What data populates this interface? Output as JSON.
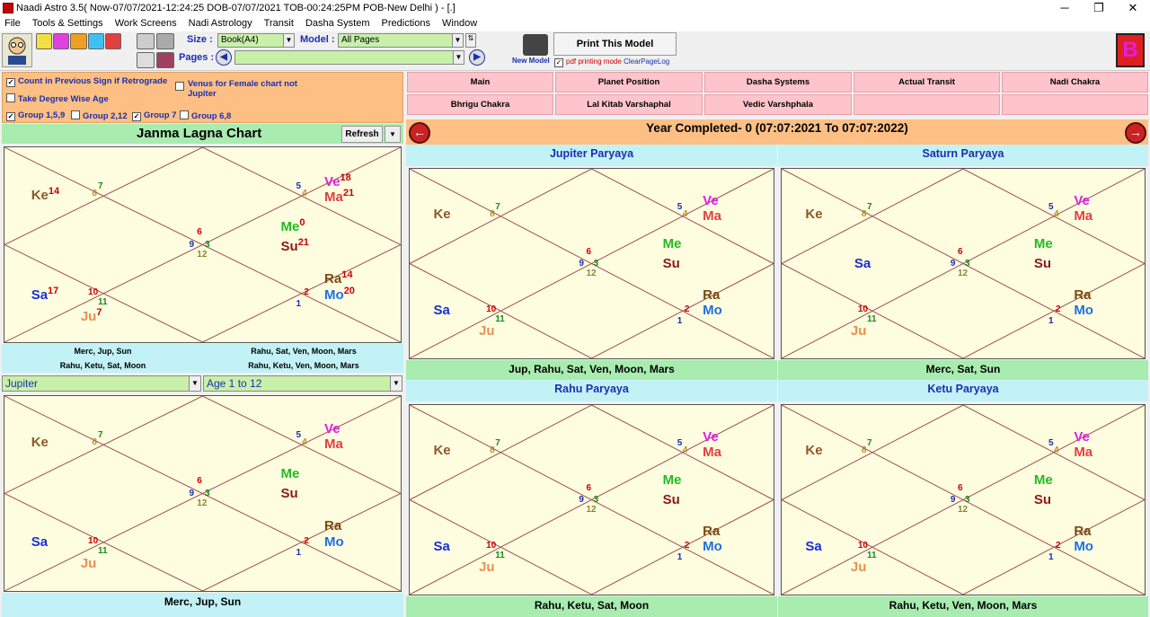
{
  "window": {
    "title": "Naadi Astro 3.5( Now-07/07/2021-12:24:25 DOB-07/07/2021 TOB-00:24:25PM POB-New Delhi ) - [.]",
    "minimize": "─",
    "maximize": "❐",
    "close": "✕"
  },
  "menu": [
    "File",
    "Tools & Settings",
    "Work Screens",
    "Nadi Astrology",
    "Transit",
    "Dasha System",
    "Predictions",
    "Window"
  ],
  "toolbar": {
    "size_label": "Size :",
    "size_value": "Book(A4)",
    "model_label": "Model :",
    "model_value": "All Pages",
    "pages_label": "Pages :",
    "pages_value": "",
    "print_label": "Print This Model",
    "new_model": "New Model",
    "pdf_label": "pdf printing mode",
    "clear_log": "ClearPageLog",
    "logo_letter": "B"
  },
  "options": {
    "count_prev": "Count in Previous Sign if Retrograde",
    "degree_age": "Take Degree Wise Age",
    "venus_female": "Venus for Female chart not Jupiter",
    "group159": "Group 1,5,9",
    "group212": "Group 2,12",
    "group7": "Group 7",
    "group68": "Group 6,8"
  },
  "lagna": {
    "title": "Janma Lagna Chart",
    "refresh": "Refresh"
  },
  "houses": [
    "6",
    "7",
    "5",
    "8",
    "4",
    "9",
    "3",
    "12",
    "10",
    "2",
    "11",
    "1"
  ],
  "main_chart": {
    "ke": "Ke",
    "ke_deg": "14",
    "ve": "Ve",
    "ve_deg": "18",
    "ma": "Ma",
    "ma_deg": "21",
    "me": "Me",
    "me_deg": "0",
    "su": "Su",
    "su_deg": "21",
    "ra": "Ra",
    "ra_deg": "14",
    "mo": "Mo",
    "mo_deg": "20",
    "sa": "Sa",
    "sa_deg": "17",
    "ju": "Ju",
    "ju_deg": "7"
  },
  "groups": {
    "g1": "Merc, Jup, Sun",
    "g2": "Rahu, Sat, Ven, Moon, Mars",
    "g3": "Rahu, Ketu, Sat, Moon",
    "g4": "Rahu, Ketu, Ven, Moon, Mars"
  },
  "selectors": {
    "planet": "Jupiter",
    "age": "Age 1 to 12"
  },
  "lower_left_footer": "Merc, Jup, Sun",
  "tabs": [
    "Main",
    "Planet Position",
    "Dasha Systems",
    "Actual Transit",
    "Nadi Chakra",
    "Bhrigu Chakra",
    "Lal Kitab Varshaphal",
    "Vedic Varshphala",
    ""
  ],
  "year": {
    "text": "Year Completed- 0 (07:07:2021 To 07:07:2022)",
    "prev": "←",
    "next": "→"
  },
  "paryaya": [
    {
      "title": "Jupiter Paryaya",
      "footer": "Jup, Rahu, Sat, Ven, Moon, Mars"
    },
    {
      "title": "Saturn Paryaya",
      "footer": "Merc, Sat, Sun"
    },
    {
      "title": "Rahu Paryaya",
      "footer": "Rahu, Ketu, Sat, Moon"
    },
    {
      "title": "Ketu Paryaya",
      "footer": "Rahu, Ketu, Ven, Moon, Mars"
    }
  ],
  "planets": {
    "ke": "Ke",
    "ve": "Ve",
    "ma": "Ma",
    "me": "Me",
    "su": "Su",
    "ra": "Ra",
    "mo": "Mo",
    "sa": "Sa",
    "ju": "Ju"
  },
  "colors": {
    "ke": "#8b5a2b",
    "ve": "#e020e0",
    "ma": "#e04040",
    "me": "#22bb22",
    "su": "#8b1a1a",
    "ra": "#7a4a10",
    "mo": "#1e6fe0",
    "sa": "#1a2fd0",
    "ju": "#e89050"
  }
}
